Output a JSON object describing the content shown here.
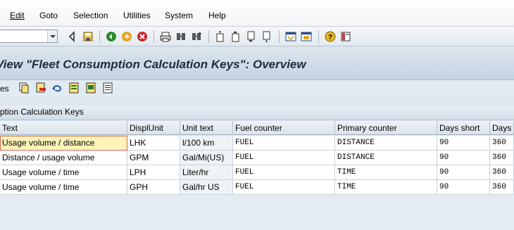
{
  "menu": {
    "items": [
      "Edit",
      "Goto",
      "Selection",
      "Utilities",
      "System",
      "Help"
    ]
  },
  "title": "View \"Fleet Consumption Calculation Keys\": Overview",
  "app_toolbar": {
    "label": "es"
  },
  "table": {
    "title": "ption Calculation Keys",
    "headers": [
      "Text",
      "DisplUnit",
      "Unit text",
      "Fuel counter",
      "Primary counter",
      "Days short",
      "Days l"
    ],
    "rows": [
      [
        "Usage volume / distance",
        "LHK",
        "l/100 km",
        "FUEL",
        "DISTANCE",
        "90",
        "360"
      ],
      [
        "Distance / usage volume",
        "GPM",
        "Gal/Mi(US)",
        "FUEL",
        "DISTANCE",
        "90",
        "360"
      ],
      [
        "Usage volume / time",
        "LPH",
        "Liter/hr",
        "FUEL",
        "TIME",
        "90",
        "360"
      ],
      [
        "Usage volume / time",
        "GPH",
        "Gal/hr US",
        "FUEL",
        "TIME",
        "90",
        "360"
      ]
    ]
  },
  "colors": {
    "title_text": "#1c2c3c",
    "selected_cell": "#fff5b8"
  }
}
